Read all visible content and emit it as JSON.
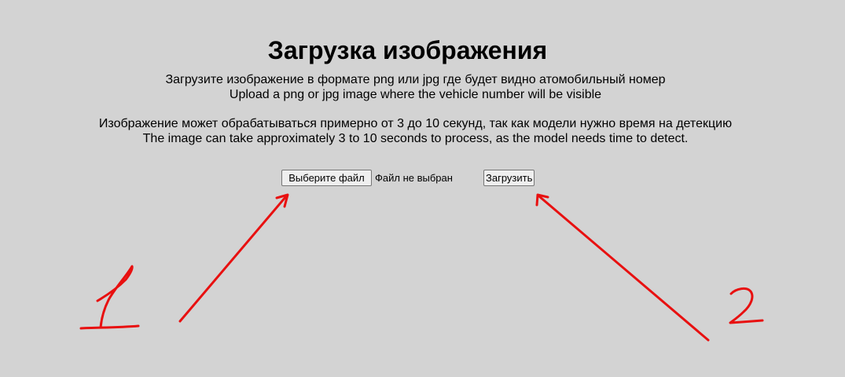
{
  "page": {
    "title": "Загрузка изображения",
    "instruction_ru": "Загрузите изображение в формате png или jpg где будет видно атомобильный номер",
    "instruction_en": "Upload a png or jpg image where the vehicle number will be visible",
    "processing_ru": "Изображение может обрабатываться примерно от 3 до 10 секунд, так как модели нужно время на детекцию",
    "processing_en": "The image can take approximately 3 to 10 seconds to process, as the model needs time to detect."
  },
  "form": {
    "file_button_label": "Выберите файл",
    "file_status": "Файл не выбран",
    "upload_button_label": "Загрузить"
  },
  "annotations": {
    "color": "#e81010"
  },
  "colors": {
    "background": "#d3d3d3",
    "button_bg": "#efefef",
    "button_border": "#767676"
  }
}
